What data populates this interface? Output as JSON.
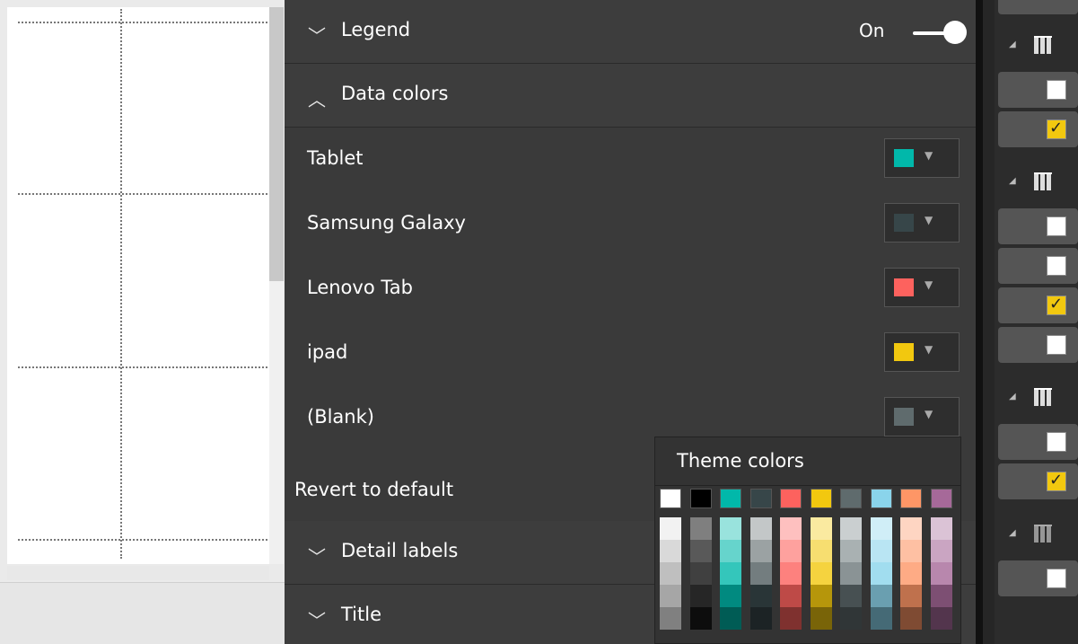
{
  "format_pane": {
    "legend": {
      "label": "Legend",
      "toggle_label": "On"
    },
    "data_colors": {
      "label": "Data colors",
      "items": [
        {
          "name": "Tablet",
          "color": "#01b8aa"
        },
        {
          "name": "Samsung Galaxy",
          "color": "#374649"
        },
        {
          "name": "Lenovo Tab",
          "color": "#fd625e"
        },
        {
          "name": "ipad",
          "color": "#f2c80f"
        },
        {
          "name": "(Blank)",
          "color": "#5f6b6d"
        }
      ],
      "revert_label": "Revert to default"
    },
    "detail_labels": {
      "label": "Detail labels"
    },
    "title": {
      "label": "Title"
    }
  },
  "color_popup": {
    "title": "Theme colors",
    "theme_colors": [
      "#ffffff",
      "#000000",
      "#01b8aa",
      "#374649",
      "#fd625e",
      "#f2c80f",
      "#5f6b6d",
      "#8ad4eb",
      "#fe9666",
      "#a66999"
    ],
    "shades": [
      [
        "#f2f2f2",
        "#d9d9d9",
        "#bfbfbf",
        "#a6a6a6",
        "#808080"
      ],
      [
        "#7f7f7f",
        "#595959",
        "#404040",
        "#262626",
        "#0d0d0d"
      ],
      [
        "#99e3dd",
        "#66d4cc",
        "#34c6bb",
        "#018a80",
        "#005c55"
      ],
      [
        "#c3c7c8",
        "#9ba2a3",
        "#737d7f",
        "#293537",
        "#1c2325"
      ],
      [
        "#fec0bf",
        "#fea19e",
        "#fd817e",
        "#be4a47",
        "#7f312f"
      ],
      [
        "#faeaa0",
        "#f7de70",
        "#f5d33f",
        "#b6960b",
        "#796408"
      ],
      [
        "#cacfd0",
        "#a9b1b2",
        "#8a9395",
        "#475052",
        "#303637"
      ],
      [
        "#d0eef7",
        "#b9e5f3",
        "#a1ddef",
        "#6a9fb0",
        "#456a76"
      ],
      [
        "#fed5c2",
        "#fec0a3",
        "#feab85",
        "#bf714d",
        "#7f4b33"
      ],
      [
        "#dbc3d6",
        "#caa5c2",
        "#b887ad",
        "#7d4f73",
        "#53354d"
      ]
    ]
  },
  "fields": {
    "tables": [
      {
        "checks": [
          false,
          true
        ]
      },
      {
        "checks": [
          false,
          false,
          true,
          false
        ]
      },
      {
        "checks": [
          false,
          true
        ]
      },
      {
        "checks": [
          false
        ]
      }
    ]
  }
}
